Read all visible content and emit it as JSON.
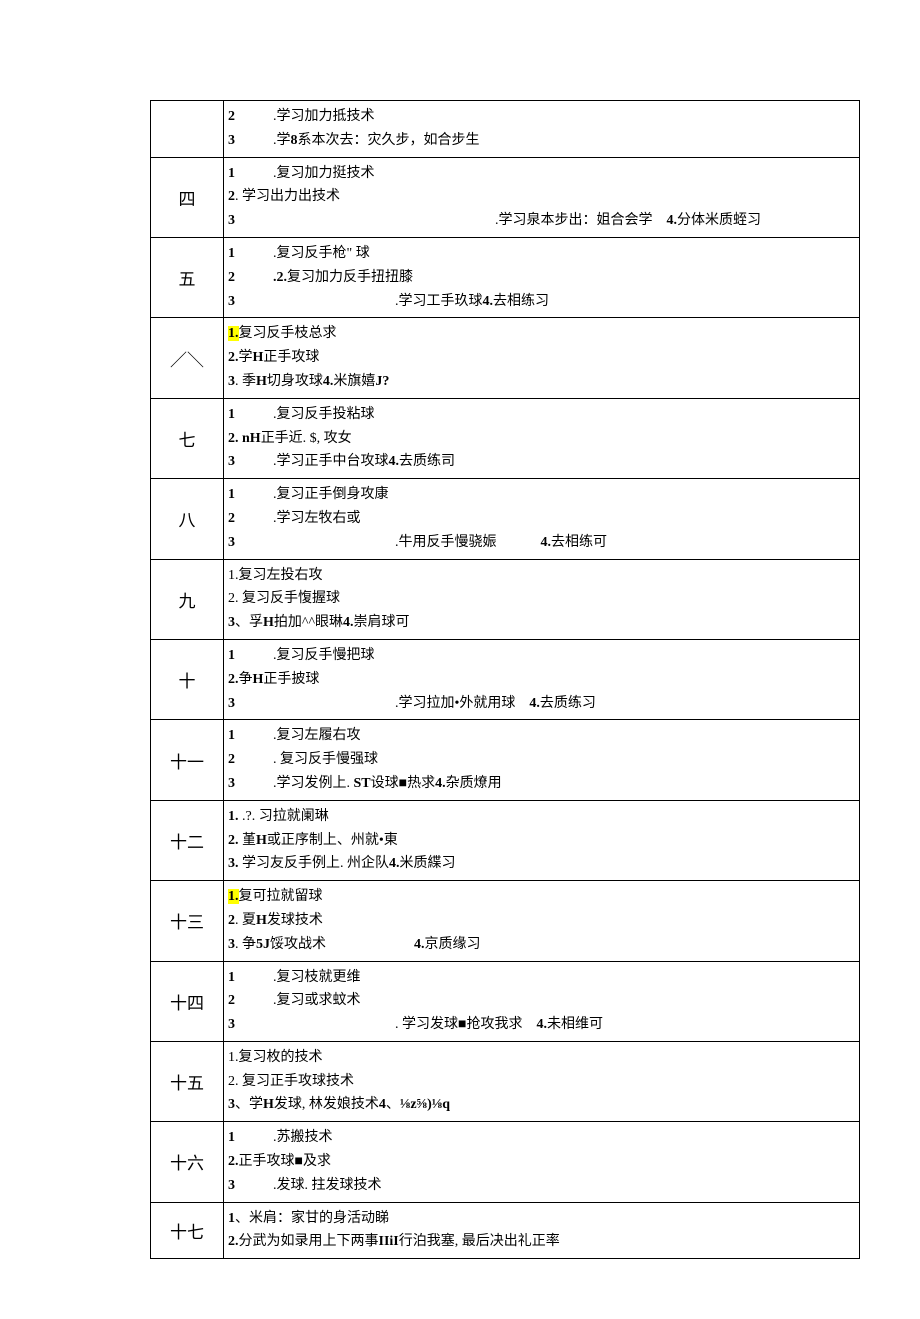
{
  "rows": [
    {
      "label": "",
      "lines": [
        {
          "segments": [
            {
              "t": "2",
              "cls": "num"
            },
            {
              "t": "",
              "cls": "gap-s"
            },
            {
              "t": ".学习加力抵技术"
            }
          ]
        },
        {
          "segments": [
            {
              "t": "3",
              "cls": "num"
            },
            {
              "t": "",
              "cls": "gap-s"
            },
            {
              "t": ".学"
            },
            {
              "t": "8",
              "cls": "b"
            },
            {
              "t": "系本次去：灾久步，如合步生"
            }
          ]
        }
      ]
    },
    {
      "label": "四",
      "lines": [
        {
          "segments": [
            {
              "t": "1",
              "cls": "num"
            },
            {
              "t": "",
              "cls": "gap-s"
            },
            {
              "t": ".复习加力挺技术"
            }
          ]
        },
        {
          "segments": [
            {
              "t": "2",
              "cls": "num"
            },
            {
              "t": ". 学习出力出技术"
            }
          ]
        },
        {
          "segments": [
            {
              "t": "3",
              "cls": "num"
            },
            {
              "t": "",
              "cls": "gap-l"
            },
            {
              "t": ".学习泉本步出：姐合会学"
            },
            {
              "t": "",
              "cls": "gap-xs"
            },
            {
              "t": "4.",
              "cls": "b"
            },
            {
              "t": "分体米质蛭习"
            }
          ]
        }
      ]
    },
    {
      "label": "五",
      "lines": [
        {
          "segments": [
            {
              "t": "1",
              "cls": "num"
            },
            {
              "t": "",
              "cls": "gap-s"
            },
            {
              "t": ".复习反手枪\" 球"
            }
          ]
        },
        {
          "segments": [
            {
              "t": "2",
              "cls": "num"
            },
            {
              "t": "",
              "cls": "gap-s"
            },
            {
              "t": ".2.",
              "cls": "b"
            },
            {
              "t": "复习加力反手扭扭膝"
            }
          ]
        },
        {
          "segments": [
            {
              "t": "3",
              "cls": "num"
            },
            {
              "t": "",
              "cls": "gap-m"
            },
            {
              "t": ".学习工手玖球"
            },
            {
              "t": "4.",
              "cls": "b"
            },
            {
              "t": "去相练习"
            }
          ]
        }
      ]
    },
    {
      "label": "／＼",
      "lines": [
        {
          "segments": [
            {
              "t": "1.",
              "cls": "hl b"
            },
            {
              "t": "复习反手枝总求"
            }
          ]
        },
        {
          "segments": [
            {
              "t": "2.",
              "cls": "b"
            },
            {
              "t": "学"
            },
            {
              "t": "H",
              "cls": "b"
            },
            {
              "t": "正手攻球"
            }
          ]
        },
        {
          "segments": [
            {
              "t": "3",
              "cls": "b"
            },
            {
              "t": ". 季"
            },
            {
              "t": "H",
              "cls": "b"
            },
            {
              "t": "切身攻球"
            },
            {
              "t": "4.",
              "cls": "b"
            },
            {
              "t": "米旗嬉"
            },
            {
              "t": "J?",
              "cls": "b"
            }
          ]
        }
      ]
    },
    {
      "label": "七",
      "lines": [
        {
          "segments": [
            {
              "t": "1",
              "cls": "num"
            },
            {
              "t": "",
              "cls": "gap-s"
            },
            {
              "t": ".复习反手投粘球"
            }
          ]
        },
        {
          "segments": [
            {
              "t": "2",
              "cls": "b"
            },
            {
              "t": ". nH",
              "cls": "b"
            },
            {
              "t": "正手近. $, 攻女"
            }
          ]
        },
        {
          "segments": [
            {
              "t": "3",
              "cls": "num"
            },
            {
              "t": "",
              "cls": "gap-s"
            },
            {
              "t": ".学习正手中台攻球"
            },
            {
              "t": "4.",
              "cls": "b"
            },
            {
              "t": "去质练司"
            }
          ]
        }
      ]
    },
    {
      "label": "八",
      "lines": [
        {
          "segments": [
            {
              "t": "1",
              "cls": "num"
            },
            {
              "t": "",
              "cls": "gap-s"
            },
            {
              "t": ".复习正手倒身攻康"
            }
          ]
        },
        {
          "segments": [
            {
              "t": "2",
              "cls": "num"
            },
            {
              "t": "",
              "cls": "gap-s"
            },
            {
              "t": ".学习左牧右或"
            }
          ]
        },
        {
          "segments": [
            {
              "t": "3",
              "cls": "num"
            },
            {
              "t": "",
              "cls": "gap-m"
            },
            {
              "t": ".牛用反手慢骁娠"
            },
            {
              "t": "",
              "cls": "space-after"
            },
            {
              "t": "4.",
              "cls": "b"
            },
            {
              "t": "去相练可"
            }
          ]
        }
      ]
    },
    {
      "label": "九",
      "lines": [
        {
          "segments": [
            {
              "t": "1.复习左投右攻"
            }
          ]
        },
        {
          "segments": [
            {
              "t": "2. 复习反手愎握球"
            }
          ]
        },
        {
          "segments": [
            {
              "t": "3",
              "cls": "b"
            },
            {
              "t": "、孚"
            },
            {
              "t": "H",
              "cls": "b"
            },
            {
              "t": "拍加^^眼琳"
            },
            {
              "t": "4.",
              "cls": "b"
            },
            {
              "t": "崇肩球可"
            }
          ]
        }
      ]
    },
    {
      "label": "十",
      "lines": [
        {
          "segments": [
            {
              "t": "1",
              "cls": "num"
            },
            {
              "t": "",
              "cls": "gap-s"
            },
            {
              "t": ".复习反手慢把球"
            }
          ]
        },
        {
          "segments": [
            {
              "t": "2.",
              "cls": "b"
            },
            {
              "t": "争"
            },
            {
              "t": "H",
              "cls": "b"
            },
            {
              "t": "正手披球"
            }
          ]
        },
        {
          "segments": [
            {
              "t": "3",
              "cls": "num"
            },
            {
              "t": "",
              "cls": "gap-m"
            },
            {
              "t": ".学习拉加•外就用球"
            },
            {
              "t": "",
              "cls": "gap-xs"
            },
            {
              "t": "4.",
              "cls": "b"
            },
            {
              "t": "去质练习"
            }
          ]
        }
      ]
    },
    {
      "label": "十一",
      "lines": [
        {
          "segments": [
            {
              "t": "1",
              "cls": "num"
            },
            {
              "t": "",
              "cls": "gap-s"
            },
            {
              "t": ".复习左履右攻"
            }
          ]
        },
        {
          "segments": [
            {
              "t": "2",
              "cls": "num"
            },
            {
              "t": "",
              "cls": "gap-s"
            },
            {
              "t": ". 复习反手慢强球"
            }
          ]
        },
        {
          "segments": [
            {
              "t": "3",
              "cls": "num"
            },
            {
              "t": "",
              "cls": "gap-s"
            },
            {
              "t": ".学习发例上. "
            },
            {
              "t": "ST",
              "cls": "b"
            },
            {
              "t": "设球■热求"
            },
            {
              "t": "4.",
              "cls": "b"
            },
            {
              "t": "杂质燎用"
            }
          ]
        }
      ]
    },
    {
      "label": "十二",
      "lines": [
        {
          "segments": [
            {
              "t": "1.",
              "cls": "b"
            },
            {
              "t": "  .?. 习拉就阑琳"
            }
          ]
        },
        {
          "segments": [
            {
              "t": "2.",
              "cls": "b"
            },
            {
              "t": "  堇"
            },
            {
              "t": "H",
              "cls": "b"
            },
            {
              "t": "或正序制上、州就•東"
            }
          ]
        },
        {
          "segments": [
            {
              "t": "3.",
              "cls": "b"
            },
            {
              "t": "  学习友反手例上. 州企队"
            },
            {
              "t": "4.",
              "cls": "b"
            },
            {
              "t": "米质緤习"
            }
          ]
        }
      ]
    },
    {
      "label": "十三",
      "lines": [
        {
          "segments": [
            {
              "t": "1.",
              "cls": "hl b"
            },
            {
              "t": "复可拉就留球"
            }
          ]
        },
        {
          "segments": [
            {
              "t": "2",
              "cls": "b"
            },
            {
              "t": ". 夏"
            },
            {
              "t": "H",
              "cls": "b"
            },
            {
              "t": "发球技术"
            }
          ]
        },
        {
          "segments": [
            {
              "t": "3",
              "cls": "b"
            },
            {
              "t": ". 争"
            },
            {
              "t": "5J",
              "cls": "b"
            },
            {
              "t": "馁攻战术"
            },
            {
              "t": "",
              "cls": "space-after"
            },
            {
              "t": "",
              "cls": "space-after"
            },
            {
              "t": "4.",
              "cls": "b"
            },
            {
              "t": "京质缘习"
            }
          ]
        }
      ]
    },
    {
      "label": "十四",
      "lines": [
        {
          "segments": [
            {
              "t": "1",
              "cls": "num"
            },
            {
              "t": "",
              "cls": "gap-s"
            },
            {
              "t": ".复习枝就更维"
            }
          ]
        },
        {
          "segments": [
            {
              "t": "2",
              "cls": "num"
            },
            {
              "t": "",
              "cls": "gap-s"
            },
            {
              "t": ".复习或求蚊术"
            }
          ]
        },
        {
          "segments": [
            {
              "t": "3",
              "cls": "num"
            },
            {
              "t": "",
              "cls": "gap-m"
            },
            {
              "t": ". 学习发球■抢攻我求"
            },
            {
              "t": "",
              "cls": "gap-xs"
            },
            {
              "t": "4.",
              "cls": "b"
            },
            {
              "t": "未相维可"
            }
          ]
        }
      ]
    },
    {
      "label": "十五",
      "lines": [
        {
          "segments": [
            {
              "t": "1.复习枚的技术"
            }
          ]
        },
        {
          "segments": [
            {
              "t": "2. 复习正手攻球技术"
            }
          ]
        },
        {
          "segments": [
            {
              "t": "3",
              "cls": "b"
            },
            {
              "t": "、学"
            },
            {
              "t": "H",
              "cls": "b"
            },
            {
              "t": "发球, 林发娘技术"
            },
            {
              "t": "4",
              "cls": "b"
            },
            {
              "t": "、"
            },
            {
              "t": "⅛z⅝)⅛q",
              "cls": "b"
            }
          ]
        }
      ]
    },
    {
      "label": "十六",
      "lines": [
        {
          "segments": [
            {
              "t": "1",
              "cls": "num"
            },
            {
              "t": "",
              "cls": "gap-s"
            },
            {
              "t": ".苏搬技术"
            }
          ]
        },
        {
          "segments": [
            {
              "t": "2.",
              "cls": "b"
            },
            {
              "t": "正手攻球■及求"
            }
          ]
        },
        {
          "segments": [
            {
              "t": "3",
              "cls": "num"
            },
            {
              "t": "",
              "cls": "gap-s"
            },
            {
              "t": ".发球. 拄发球技术"
            }
          ]
        }
      ]
    },
    {
      "label": "十七",
      "lines": [
        {
          "segments": [
            {
              "t": "1",
              "cls": "b"
            },
            {
              "t": "、米肩：家甘的身活动睇"
            }
          ]
        },
        {
          "segments": [
            {
              "t": "2.",
              "cls": "b"
            },
            {
              "t": "分武为如录用上下两事"
            },
            {
              "t": "IIiI",
              "cls": "b"
            },
            {
              "t": "行泊我塞, 最后决出礼正率"
            }
          ]
        }
      ]
    }
  ]
}
